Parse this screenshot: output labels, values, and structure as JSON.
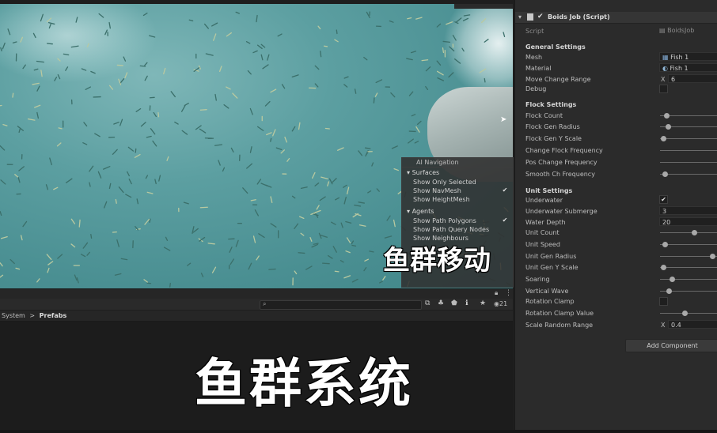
{
  "ai_navigation": {
    "title": "AI Navigation",
    "surfaces_header": "Surfaces",
    "surfaces": [
      {
        "label": "Show Only Selected",
        "checked": false
      },
      {
        "label": "Show NavMesh",
        "checked": true
      },
      {
        "label": "Show HeightMesh",
        "checked": false
      }
    ],
    "agents_header": "Agents",
    "agents": [
      {
        "label": "Show Path Polygons",
        "checked": true
      },
      {
        "label": "Show Path Query Nodes",
        "checked": false
      },
      {
        "label": "Show Neighbours",
        "checked": false
      }
    ]
  },
  "scene_toolbar": {
    "visible_count": "21"
  },
  "breadcrumb": {
    "parent": "System",
    "separator": ">",
    "current": "Prefabs"
  },
  "captions": {
    "scene_caption": "鱼群移动",
    "main_caption": "鱼群系统"
  },
  "inspector": {
    "component_title": "Boids Job (Script)",
    "script": {
      "label": "Script",
      "value": "BoidsJob"
    },
    "general": {
      "header": "General Settings",
      "mesh_label": "Mesh",
      "mesh_value": "Fish 1",
      "material_label": "Material",
      "material_value": "Fish 1",
      "move_change_range_label": "Move Change Range",
      "move_change_range_axis": "X",
      "move_change_range_value": "6",
      "debug_label": "Debug"
    },
    "flock": {
      "header": "Flock Settings",
      "flock_count_label": "Flock Count",
      "flock_gen_radius_label": "Flock Gen Radius",
      "flock_gen_y_scale_label": "Flock Gen Y Scale",
      "change_flock_frequency_label": "Change Flock Frequency",
      "pos_change_frequency_label": "Pos Change Frequency",
      "smooth_ch_frequency_label": "Smooth Ch Frequency"
    },
    "unit": {
      "header": "Unit Settings",
      "underwater_label": "Underwater",
      "underwater_submerge_label": "Underwater Submerge",
      "underwater_submerge_value": "3",
      "water_depth_label": "Water Depth",
      "water_depth_value": "20",
      "unit_count_label": "Unit Count",
      "unit_speed_label": "Unit Speed",
      "unit_gen_radius_label": "Unit Gen Radius",
      "unit_gen_y_scale_label": "Unit Gen Y Scale",
      "soaring_label": "Soaring",
      "vertical_wave_label": "Vertical Wave",
      "rotation_clamp_label": "Rotation Clamp",
      "rotation_clamp_value_label": "Rotation Clamp Value",
      "scale_random_range_label": "Scale Random Range",
      "scale_random_range_axis": "X",
      "scale_random_range_value": "0.4"
    },
    "add_component_label": "Add Component",
    "slider_levels": {
      "flock_count": 0.08,
      "flock_gen_radius": 0.1,
      "flock_gen_y_scale": 0.02,
      "smooth_ch_frequency": 0.05,
      "unit_count": 0.6,
      "unit_speed": 0.05,
      "unit_gen_radius": 0.95,
      "unit_gen_y_scale": 0.02,
      "soaring": 0.18,
      "vertical_wave": 0.12,
      "rotation_clamp_value": 0.42
    }
  }
}
